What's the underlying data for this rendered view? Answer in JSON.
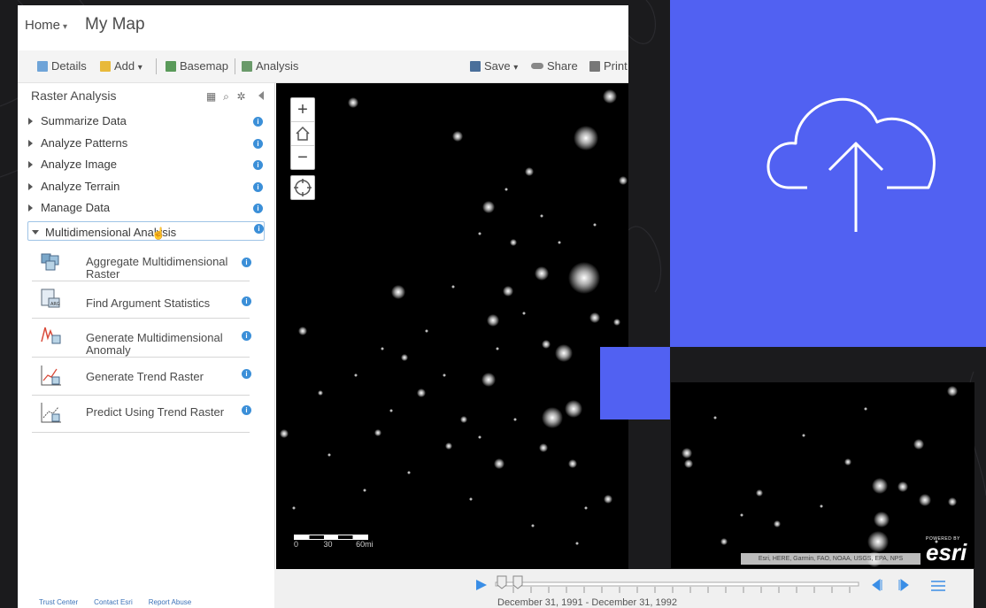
{
  "header": {
    "home_label": "Home",
    "home_caret": "▾",
    "map_title": "My Map"
  },
  "toolbar": {
    "details": "Details",
    "add": "Add",
    "add_caret": "▾",
    "basemap": "Basemap",
    "analysis": "Analysis",
    "save": "Save",
    "save_caret": "▾",
    "share": "Share",
    "print": "Print"
  },
  "panel": {
    "title": "Raster Analysis",
    "categories": [
      {
        "label": "Summarize Data"
      },
      {
        "label": "Analyze Patterns"
      },
      {
        "label": "Analyze Image"
      },
      {
        "label": "Analyze Terrain"
      },
      {
        "label": "Manage Data"
      },
      {
        "label": "Multidimensional Analysis"
      }
    ],
    "tools": [
      {
        "label_line1": "Aggregate Multidimensional",
        "label_line2": "Raster"
      },
      {
        "label_line1": "Find Argument Statistics",
        "label_line2": ""
      },
      {
        "label_line1": "Generate Multidimensional",
        "label_line2": "Anomaly"
      },
      {
        "label_line1": "Generate Trend Raster",
        "label_line2": ""
      },
      {
        "label_line1": "Predict Using Trend Raster",
        "label_line2": ""
      }
    ]
  },
  "footer": {
    "trust": "Trust Center",
    "contact": "Contact Esri",
    "report": "Report Abuse"
  },
  "map": {
    "zoom_in": "+",
    "zoom_out": "−",
    "scale": {
      "s0": "0",
      "s30": "30",
      "s60": "60mi"
    },
    "attribution": "Esri, HERE, Garmin, FAO, NOAA, USGS, EPA, NPS",
    "esri_powered": "POWERED BY",
    "esri_name": "esri"
  },
  "time_slider": {
    "range": "December 31, 1991 - December 31, 1992"
  },
  "colors": {
    "accent_blue": "#5161f2",
    "info_blue": "#3b8fd8",
    "link_blue": "#3b72b8"
  }
}
